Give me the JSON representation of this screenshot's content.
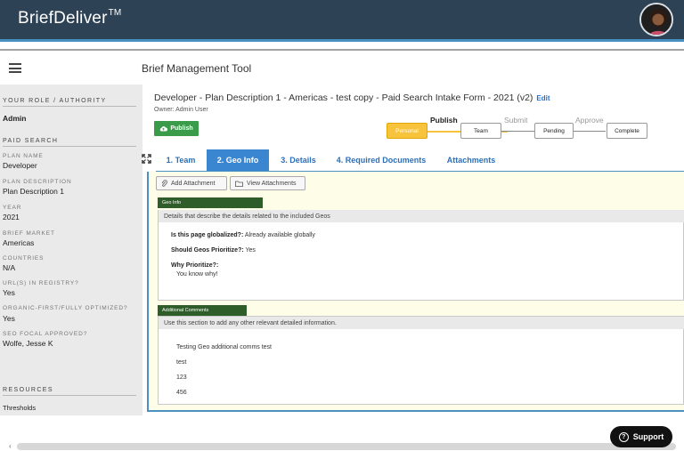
{
  "app": {
    "brand": "BriefDeliver",
    "brand_mark": "TM",
    "tool_title": "Brief Management Tool"
  },
  "sidebar": {
    "role_heading": "Your Role / Authority",
    "role_value": "Admin",
    "section_heading": "Paid Search",
    "fields": [
      {
        "label": "Plan Name",
        "value": "Developer"
      },
      {
        "label": "Plan Description",
        "value": "Plan Description 1"
      },
      {
        "label": "Year",
        "value": "2021"
      },
      {
        "label": "Brief Market",
        "value": "Americas"
      },
      {
        "label": "Countries",
        "value": "N/A"
      },
      {
        "label": "URL(s) In Registry?",
        "value": "Yes"
      },
      {
        "label": "Organic-first/fully optimized?",
        "value": "Yes"
      },
      {
        "label": "SEO Focal Approved?",
        "value": "Wolfe, Jesse K"
      }
    ],
    "resources_heading": "Resources",
    "resources_link": "Thresholds"
  },
  "document": {
    "title": "Developer - Plan Description 1 - Americas - test copy - Paid Search Intake Form - 2021 (v2)",
    "edit_label": "Edit",
    "owner": "Owner: Admin User",
    "publish_label": "Publish"
  },
  "workflow": {
    "labels": [
      "Publish",
      "Submit",
      "Approve"
    ],
    "steps": [
      "Personal",
      "Team",
      "Pending",
      "Complete"
    ]
  },
  "tabs": [
    "1. Team",
    "2. Geo Info",
    "3. Details",
    "4. Required Documents",
    "Attachments"
  ],
  "active_tab": "2. Geo Info",
  "attachments": {
    "add_label": "Add Attachment",
    "view_label": "View Attachments"
  },
  "geo_info": {
    "tag": "Geo Info",
    "description": "Details that describe the details related to the included Geos",
    "q1": "Is this page globalized?:",
    "a1": "Already available globally",
    "q2": "Should Geos Prioritize?:",
    "a2": "Yes",
    "q3": "Why Prioritize?:",
    "a3": "You know why!"
  },
  "additional": {
    "tag": "Additional Comments",
    "description": "Use this section to add any other relevant detailed information.",
    "lines": [
      "Testing Geo additional comms test",
      "test",
      "123",
      "456"
    ]
  },
  "support_label": "Support",
  "colors": {
    "header": "#2e4256",
    "accent": "#3a86d1",
    "publish_green": "#3a9b4a",
    "current_step": "#f7c23c",
    "section_tag": "#2f5d2a"
  }
}
